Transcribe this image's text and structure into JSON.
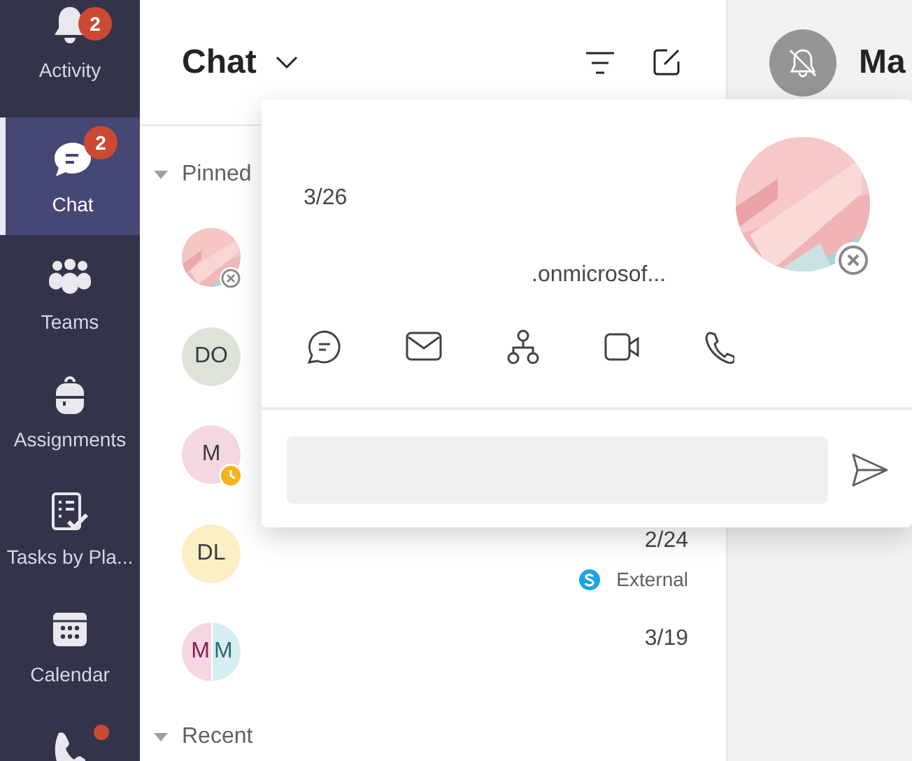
{
  "rail": {
    "items": [
      {
        "label": "Activity",
        "badge": "2",
        "selected": false
      },
      {
        "label": "Chat",
        "badge": "2",
        "selected": true
      },
      {
        "label": "Teams",
        "selected": false
      },
      {
        "label": "Assignments",
        "selected": false
      },
      {
        "label": "Tasks by Pla...",
        "selected": false
      },
      {
        "label": "Calendar",
        "selected": false
      },
      {
        "dot": true,
        "selected": false
      }
    ]
  },
  "chat_list": {
    "title": "Chat",
    "sections": [
      {
        "label": "Pinned",
        "expanded": true,
        "items": [
          {
            "blocked": true
          },
          {
            "avatar": {
              "kind": "initials",
              "initials": "DO",
              "color": "#dde3d8"
            }
          },
          {
            "avatar": {
              "kind": "initials",
              "initials": "M",
              "color": "#f4d7e2"
            },
            "away": true
          },
          {
            "avatar": {
              "kind": "initials",
              "initials": "DL",
              "color": "#fcefc6"
            },
            "time": "2/24",
            "tag": "External"
          },
          {
            "avatar": {
              "kind": "split",
              "initials": [
                "M",
                "M"
              ]
            },
            "time": "3/19"
          }
        ]
      },
      {
        "label": "Recent",
        "expanded": true
      }
    ]
  },
  "conversation": {
    "title": "Ma",
    "muted": true
  },
  "contact_card": {
    "date": "3/26",
    "email": ".onmicrosof...",
    "blocked": true
  }
}
